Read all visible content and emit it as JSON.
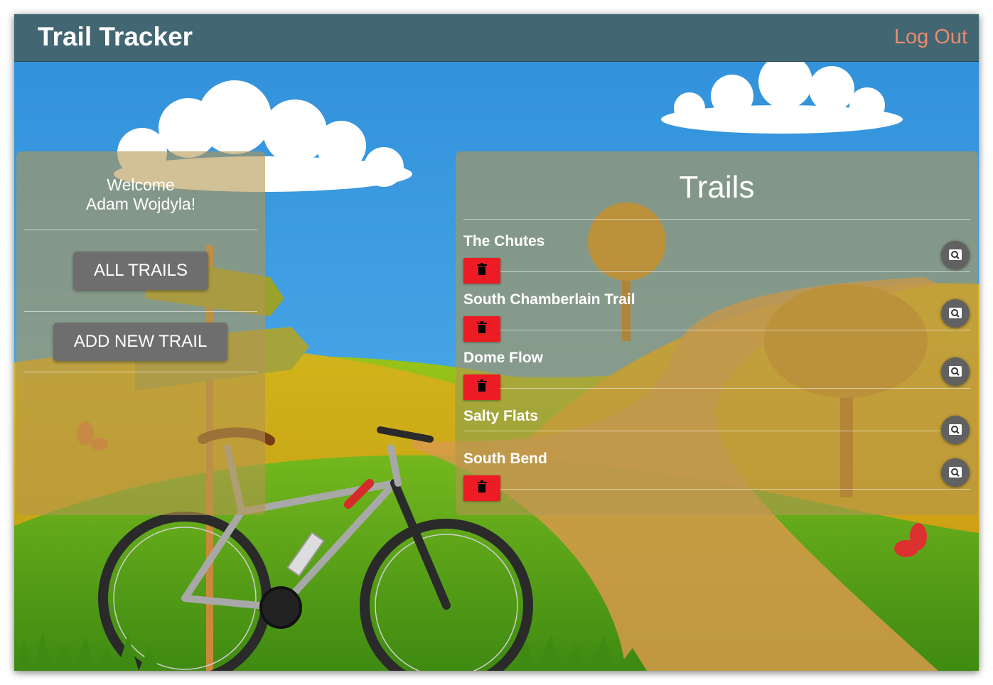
{
  "app": {
    "title": "Trail Tracker",
    "logout_label": "Log Out"
  },
  "sidebar": {
    "welcome_line1": "Welcome",
    "welcome_line2": "Adam Wojdyla!",
    "all_trails_label": "ALL TRAILS",
    "add_trail_label": "ADD NEW TRAIL"
  },
  "trails": {
    "heading": "Trails",
    "items": [
      {
        "name": "The Chutes",
        "has_delete": true
      },
      {
        "name": "South Chamberlain Trail",
        "has_delete": true
      },
      {
        "name": "Dome Flow",
        "has_delete": true
      },
      {
        "name": "Salty Flats",
        "has_delete": false
      },
      {
        "name": "South Bend",
        "has_delete": true
      }
    ]
  },
  "icons": {
    "delete": "trash-icon",
    "view": "magnifier-icon"
  },
  "colors": {
    "navbar": "#426672",
    "logout": "#e98b6b",
    "delete_button": "#ed1c24",
    "view_button": "#616161",
    "sky": "#3498db"
  }
}
